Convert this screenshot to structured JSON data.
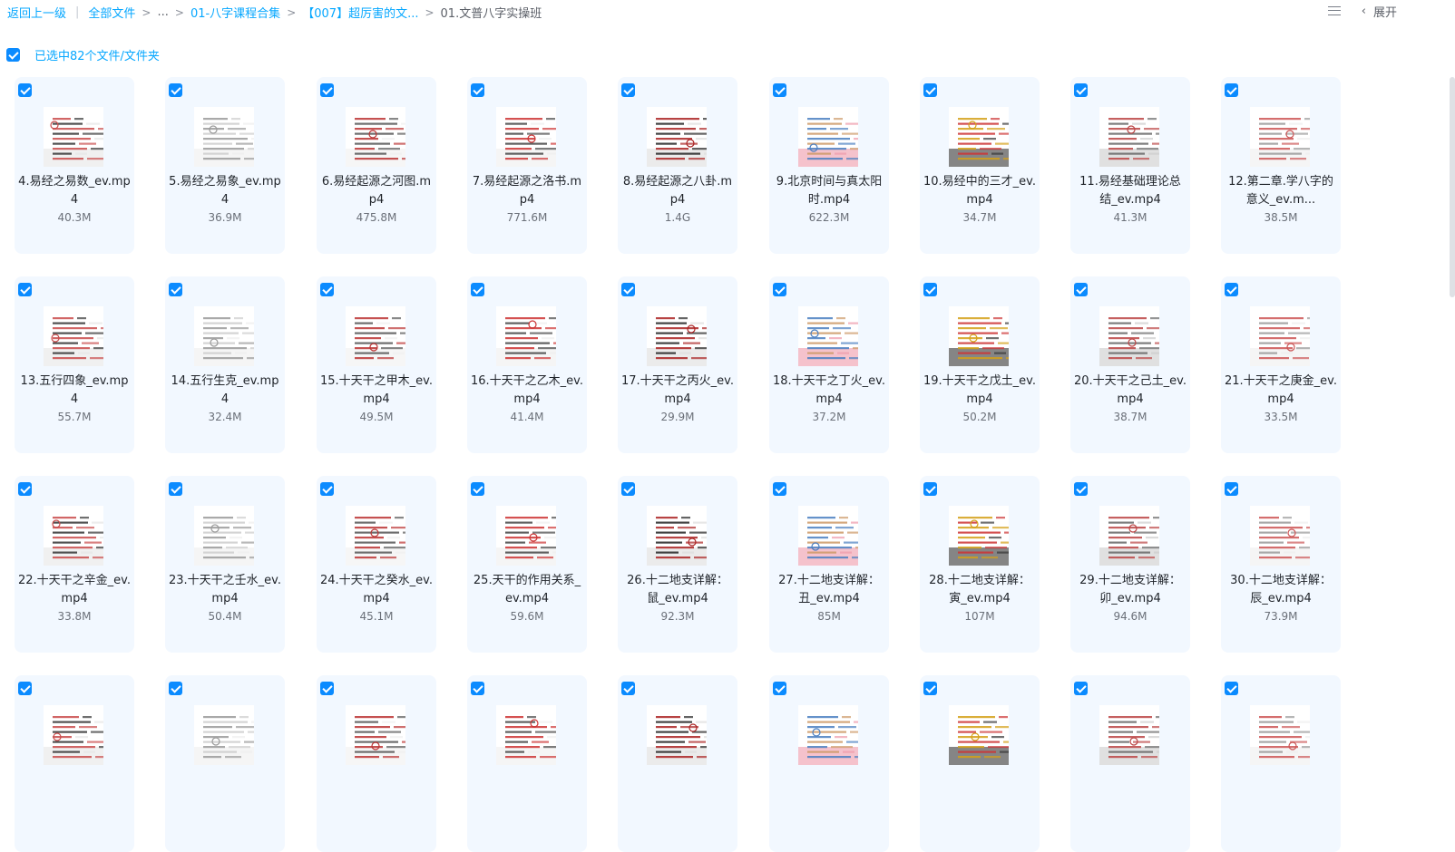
{
  "breadcrumb": {
    "back": "返回上一级",
    "all_files": "全部文件",
    "ellipsis": "...",
    "level1": "01-八字课程合集",
    "level2": "【007】超厉害的文...",
    "current": "01.文普八字实操班"
  },
  "toolbar": {
    "expand_label": "展开"
  },
  "selection": {
    "text": "已选中82个文件/文件夹"
  },
  "files": [
    {
      "name": "4.易经之易数_ev.mp4",
      "size": "40.3M"
    },
    {
      "name": "5.易经之易象_ev.mp4",
      "size": "36.9M"
    },
    {
      "name": "6.易经起源之河图.mp4",
      "size": "475.8M"
    },
    {
      "name": "7.易经起源之洛书.mp4",
      "size": "771.6M"
    },
    {
      "name": "8.易经起源之八卦.mp4",
      "size": "1.4G"
    },
    {
      "name": "9.北京时间与真太阳时.mp4",
      "size": "622.3M"
    },
    {
      "name": "10.易经中的三才_ev.mp4",
      "size": "34.7M"
    },
    {
      "name": "11.易经基础理论总结_ev.mp4",
      "size": "41.3M"
    },
    {
      "name": "12.第二章.学八字的意义_ev.m...",
      "size": "38.5M"
    },
    {
      "name": "13.五行四象_ev.mp4",
      "size": "55.7M"
    },
    {
      "name": "14.五行生克_ev.mp4",
      "size": "32.4M"
    },
    {
      "name": "15.十天干之甲木_ev.mp4",
      "size": "49.5M"
    },
    {
      "name": "16.十天干之乙木_ev.mp4",
      "size": "41.4M"
    },
    {
      "name": "17.十天干之丙火_ev.mp4",
      "size": "29.9M"
    },
    {
      "name": "18.十天干之丁火_ev.mp4",
      "size": "37.2M"
    },
    {
      "name": "19.十天干之戊土_ev.mp4",
      "size": "50.2M"
    },
    {
      "name": "20.十天干之己土_ev.mp4",
      "size": "38.7M"
    },
    {
      "name": "21.十天干之庚金_ev.mp4",
      "size": "33.5M"
    },
    {
      "name": "22.十天干之辛金_ev.mp4",
      "size": "33.8M"
    },
    {
      "name": "23.十天干之壬水_ev.mp4",
      "size": "50.4M"
    },
    {
      "name": "24.十天干之癸水_ev.mp4",
      "size": "45.1M"
    },
    {
      "name": "25.天干的作用关系_ev.mp4",
      "size": "59.6M"
    },
    {
      "name": "26.十二地支详解：鼠_ev.mp4",
      "size": "92.3M"
    },
    {
      "name": "27.十二地支详解：丑_ev.mp4",
      "size": "85M"
    },
    {
      "name": "28.十二地支详解：寅_ev.mp4",
      "size": "107M"
    },
    {
      "name": "29.十二地支详解：卯_ev.mp4",
      "size": "94.6M"
    },
    {
      "name": "30.十二地支详解：辰_ev.mp4",
      "size": "73.9M"
    },
    {
      "name": "",
      "size": ""
    },
    {
      "name": "",
      "size": ""
    },
    {
      "name": "",
      "size": ""
    },
    {
      "name": "",
      "size": ""
    },
    {
      "name": "",
      "size": ""
    },
    {
      "name": "",
      "size": ""
    },
    {
      "name": "",
      "size": ""
    },
    {
      "name": "",
      "size": ""
    },
    {
      "name": "",
      "size": ""
    }
  ],
  "colors": {
    "accent": "#06a7ff",
    "checkbox": "#0b8bff",
    "tile_bg": "#f2f8ff"
  }
}
